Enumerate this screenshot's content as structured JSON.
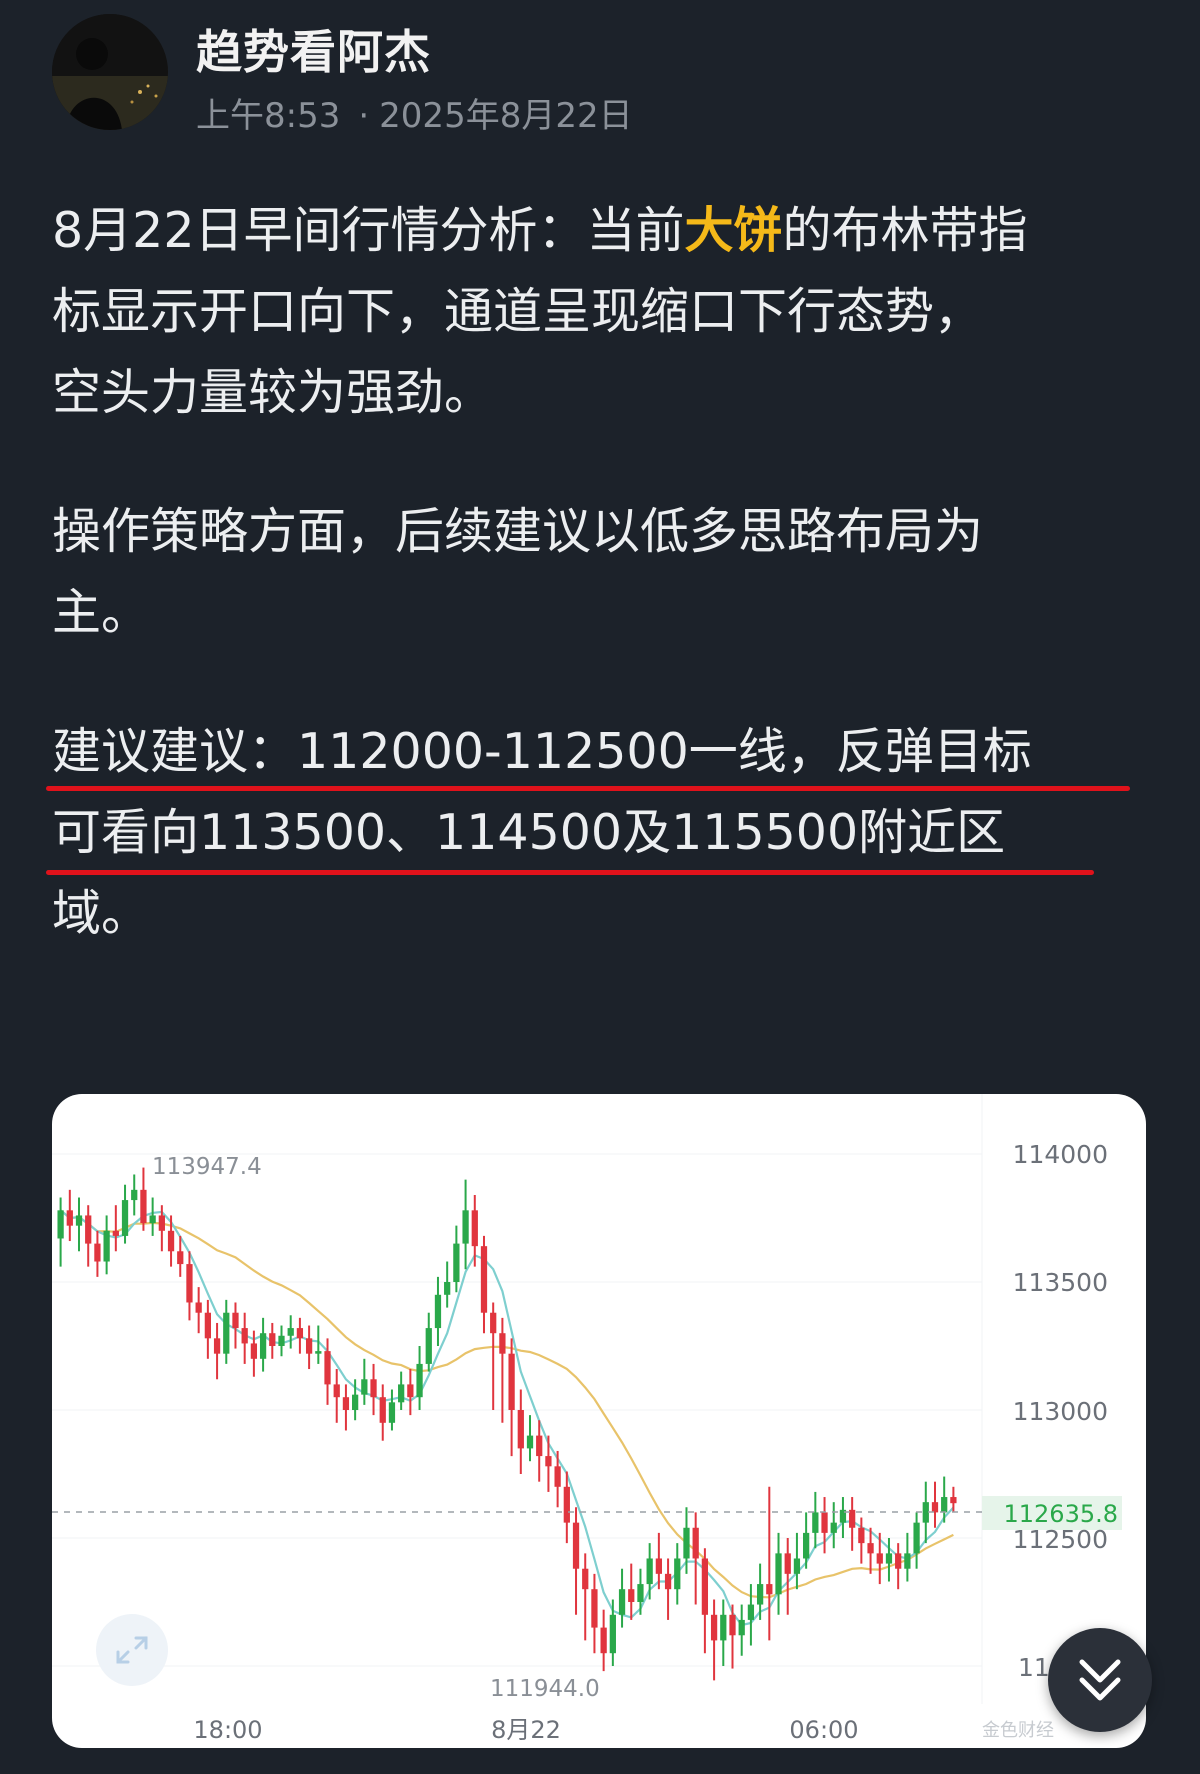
{
  "author": {
    "name": "趋势看阿杰",
    "time": "上午8:53",
    "date": "2025年8月22日"
  },
  "post": {
    "p1_before": "8月22日早间行情分析：当前",
    "p1_highlight": "大饼",
    "p1_after_l1": "的布林带指",
    "p1_line2": "标显示开口向下，通道呈现缩口下行态势，",
    "p1_line3": "空头力量较为强劲。",
    "p2_line1": "操作策略方面，后续建议以低多思路布局为",
    "p2_line2": "主。",
    "p3_line1": "建议建议：112000-112500一线，反弹目标",
    "p3_line2": "可看向113500、114500及115500附近区",
    "p3_line3": "域。"
  },
  "colors": {
    "highlight": "#f5b919",
    "underline": "#e0121b",
    "candle_up": "#2aa84a",
    "candle_down": "#e0353e",
    "ma_fast": "#7ecfcf",
    "ma_slow": "#e8c36a"
  },
  "icons": {
    "expand": "expand-arrows-icon",
    "scroll": "double-chevron-down-icon"
  },
  "chart_data": {
    "type": "candlestick",
    "y_ticks": [
      "114000",
      "113500",
      "113000",
      "112500",
      "11"
    ],
    "x_ticks": [
      "18:00",
      "8月22",
      "06:00"
    ],
    "ylim": [
      111800,
      114150
    ],
    "high_label": "113947.4",
    "low_label": "111944.0",
    "current_price_label": "112635.8",
    "current_price": 112635.8,
    "watermark": "金色财经",
    "candles": [
      [
        113670,
        113780,
        113830,
        113560
      ],
      [
        113780,
        113720,
        113860,
        113660
      ],
      [
        113720,
        113760,
        113830,
        113620
      ],
      [
        113760,
        113650,
        113800,
        113560
      ],
      [
        113650,
        113580,
        113700,
        113520
      ],
      [
        113580,
        113700,
        113760,
        113530
      ],
      [
        113700,
        113680,
        113800,
        113620
      ],
      [
        113680,
        113820,
        113880,
        113650
      ],
      [
        113820,
        113860,
        113920,
        113760
      ],
      [
        113860,
        113730,
        113947,
        113700
      ],
      [
        113730,
        113760,
        113830,
        113680
      ],
      [
        113760,
        113700,
        113800,
        113620
      ],
      [
        113700,
        113620,
        113760,
        113560
      ],
      [
        113620,
        113570,
        113680,
        113520
      ],
      [
        113570,
        113420,
        113620,
        113350
      ],
      [
        113420,
        113380,
        113480,
        113300
      ],
      [
        113380,
        113280,
        113430,
        113200
      ],
      [
        113280,
        113220,
        113340,
        113120
      ],
      [
        113220,
        113380,
        113430,
        113180
      ],
      [
        113380,
        113320,
        113420,
        113240
      ],
      [
        113320,
        113260,
        113380,
        113180
      ],
      [
        113260,
        113200,
        113310,
        113130
      ],
      [
        113200,
        113300,
        113360,
        113150
      ],
      [
        113300,
        113250,
        113340,
        113200
      ],
      [
        113250,
        113290,
        113330,
        113210
      ],
      [
        113290,
        113320,
        113370,
        113240
      ],
      [
        113320,
        113280,
        113360,
        113220
      ],
      [
        113280,
        113220,
        113330,
        113160
      ],
      [
        113220,
        113230,
        113330,
        113180
      ],
      [
        113230,
        113100,
        113280,
        113020
      ],
      [
        113100,
        113050,
        113160,
        112950
      ],
      [
        113050,
        113000,
        113100,
        112920
      ],
      [
        113000,
        113060,
        113120,
        112960
      ],
      [
        113060,
        113120,
        113200,
        113020
      ],
      [
        113120,
        113050,
        113180,
        112980
      ],
      [
        113050,
        112950,
        113100,
        112880
      ],
      [
        112950,
        113030,
        113080,
        112920
      ],
      [
        113030,
        113100,
        113150,
        113000
      ],
      [
        113100,
        113050,
        113160,
        112980
      ],
      [
        113050,
        113180,
        113250,
        113000
      ],
      [
        113180,
        113320,
        113380,
        113150
      ],
      [
        113320,
        113450,
        113520,
        113250
      ],
      [
        113450,
        113500,
        113580,
        113400
      ],
      [
        113500,
        113650,
        113720,
        113460
      ],
      [
        113650,
        113780,
        113900,
        113550
      ],
      [
        113780,
        113640,
        113840,
        113560
      ],
      [
        113640,
        113380,
        113680,
        113300
      ],
      [
        113380,
        113300,
        113420,
        113000
      ],
      [
        113300,
        113220,
        113360,
        112950
      ],
      [
        113220,
        113000,
        113280,
        112820
      ],
      [
        113000,
        112850,
        113080,
        112750
      ],
      [
        112850,
        112900,
        112980,
        112800
      ],
      [
        112900,
        112820,
        112960,
        112720
      ],
      [
        112820,
        112780,
        112900,
        112680
      ],
      [
        112780,
        112700,
        112840,
        112620
      ],
      [
        112700,
        112560,
        112760,
        112480
      ],
      [
        112560,
        112380,
        112620,
        112200
      ],
      [
        112380,
        112300,
        112440,
        112100
      ],
      [
        112300,
        112150,
        112360,
        112050
      ],
      [
        112150,
        112050,
        112220,
        111980
      ],
      [
        112050,
        112200,
        112260,
        112000
      ],
      [
        112200,
        112300,
        112380,
        112150
      ],
      [
        112300,
        112250,
        112400,
        112180
      ],
      [
        112250,
        112320,
        112380,
        112200
      ],
      [
        112320,
        112420,
        112480,
        112260
      ],
      [
        112420,
        112360,
        112520,
        112300
      ],
      [
        112360,
        112300,
        112420,
        112180
      ],
      [
        112300,
        112420,
        112480,
        112240
      ],
      [
        112420,
        112540,
        112620,
        112360
      ],
      [
        112540,
        112420,
        112600,
        112240
      ],
      [
        112420,
        112200,
        112460,
        112050
      ],
      [
        112200,
        112100,
        112260,
        111944
      ],
      [
        112100,
        112200,
        112260,
        112000
      ],
      [
        112200,
        112120,
        112240,
        111990
      ],
      [
        112120,
        112180,
        112240,
        112040
      ],
      [
        112180,
        112240,
        112320,
        112080
      ],
      [
        112240,
        112320,
        112400,
        112180
      ],
      [
        112320,
        112280,
        112700,
        112100
      ],
      [
        112280,
        112440,
        112520,
        112200
      ],
      [
        112440,
        112360,
        112500,
        112200
      ],
      [
        112360,
        112420,
        112520,
        112300
      ],
      [
        112420,
        112520,
        112600,
        112380
      ],
      [
        112520,
        112600,
        112680,
        112460
      ],
      [
        112600,
        112520,
        112660,
        112440
      ],
      [
        112520,
        112560,
        112640,
        112460
      ],
      [
        112560,
        112610,
        112660,
        112500
      ],
      [
        112610,
        112540,
        112660,
        112450
      ],
      [
        112540,
        112480,
        112580,
        112400
      ],
      [
        112480,
        112440,
        112540,
        112360
      ],
      [
        112440,
        112400,
        112520,
        112320
      ],
      [
        112400,
        112440,
        112500,
        112330
      ],
      [
        112440,
        112380,
        112480,
        112300
      ],
      [
        112380,
        112440,
        112520,
        112330
      ],
      [
        112440,
        112560,
        112600,
        112380
      ],
      [
        112560,
        112640,
        112720,
        112480
      ],
      [
        112640,
        112600,
        112720,
        112540
      ],
      [
        112600,
        112660,
        112740,
        112560
      ],
      [
        112660,
        112636,
        112700,
        112600
      ]
    ]
  }
}
